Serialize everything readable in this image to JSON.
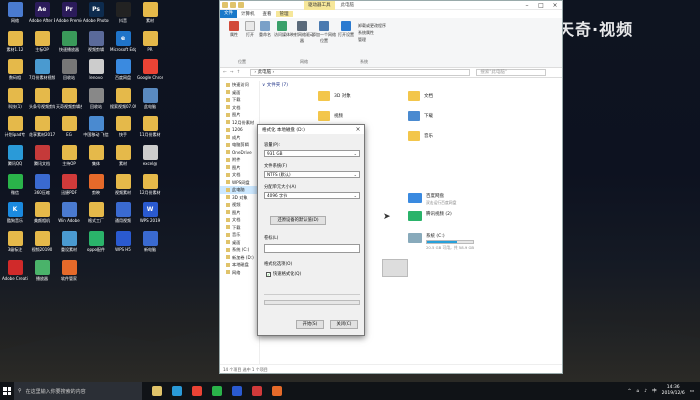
{
  "watermark": {
    "brand": "天奇·视频"
  },
  "desktop_icons": [
    {
      "label": "网络",
      "color": "#4a7bd0",
      "glyph": ""
    },
    {
      "label": "Adobe After Effects CC...",
      "color": "#2b1b5a",
      "glyph": "Ae"
    },
    {
      "label": "Adobe Premiere P...",
      "color": "#2b1b5a",
      "glyph": "Pr"
    },
    {
      "label": "Adobe Photosh...",
      "color": "#0d2b4e",
      "glyph": "Ps"
    },
    {
      "label": "抖音",
      "color": "#222222",
      "glyph": ""
    },
    {
      "label": "素材",
      "color": "#e5b94a",
      "glyph": ""
    },
    {
      "label": "素材1.12",
      "color": "#e5b94a",
      "glyph": ""
    },
    {
      "label": "主标OP",
      "color": "#e5b94a",
      "glyph": ""
    },
    {
      "label": "快速播放器",
      "color": "#3a9a5a",
      "glyph": ""
    },
    {
      "label": "视频剪辑",
      "color": "#5a6a9a",
      "glyph": ""
    },
    {
      "label": "Microsoft Edge",
      "color": "#1f74c9",
      "glyph": "e"
    },
    {
      "label": "PR",
      "color": "#e5b94a",
      "glyph": ""
    },
    {
      "label": "数码相",
      "color": "#e5b94a",
      "glyph": ""
    },
    {
      "label": "7月份素材视频",
      "color": "#4a9ad0",
      "glyph": ""
    },
    {
      "label": "回收站",
      "color": "#777777",
      "glyph": ""
    },
    {
      "label": "lenovo",
      "color": "#cccccc",
      "glyph": ""
    },
    {
      "label": "百度网盘",
      "color": "#3a8ae0",
      "glyph": ""
    },
    {
      "label": "Google Chrome",
      "color": "#ea4335",
      "glyph": ""
    },
    {
      "label": "科技(1)",
      "color": "#e5b94a",
      "glyph": ""
    },
    {
      "label": "头条号视频剪辑",
      "color": "#e5b94a",
      "glyph": ""
    },
    {
      "label": "天奇视频剪辑合",
      "color": "#e5b94a",
      "glyph": ""
    },
    {
      "label": "回收站",
      "color": "#888888",
      "glyph": ""
    },
    {
      "label": "搜索视频07.09",
      "color": "#e5b94a",
      "glyph": ""
    },
    {
      "label": "此电脑",
      "color": "#5a8ac0",
      "glyph": ""
    },
    {
      "label": "计划ipad专",
      "color": "#e5b94a",
      "glyph": ""
    },
    {
      "label": "花享素材2017.08",
      "color": "#e5b94a",
      "glyph": ""
    },
    {
      "label": "EG",
      "color": "#e5b94a",
      "glyph": ""
    },
    {
      "label": "中国移动 飞信",
      "color": "#4a8ad0",
      "glyph": ""
    },
    {
      "label": "快手",
      "color": "#e5b94a",
      "glyph": ""
    },
    {
      "label": "11月份素材",
      "color": "#e5b94a",
      "glyph": ""
    },
    {
      "label": "腾讯QQ",
      "color": "#2a9ad8",
      "glyph": ""
    },
    {
      "label": "腾讯文档",
      "color": "#c53a3a",
      "glyph": ""
    },
    {
      "label": "主持OP",
      "color": "#e5b94a",
      "glyph": ""
    },
    {
      "label": "集体",
      "color": "#e5b94a",
      "glyph": ""
    },
    {
      "label": "素材",
      "color": "#e5b94a",
      "glyph": ""
    },
    {
      "label": "excel@",
      "color": "#cccccc",
      "glyph": ""
    },
    {
      "label": "微信",
      "color": "#2ab34a",
      "glyph": ""
    },
    {
      "label": "360压缩",
      "color": "#3a6ad0",
      "glyph": ""
    },
    {
      "label": "迅捷PDF",
      "color": "#d03a3a",
      "glyph": ""
    },
    {
      "label": "剪映",
      "color": "#e56a2a",
      "glyph": ""
    },
    {
      "label": "视频素材",
      "color": "#e5b94a",
      "glyph": ""
    },
    {
      "label": "12月份素材",
      "color": "#e5b94a",
      "glyph": ""
    },
    {
      "label": "酷狗音乐",
      "color": "#1a8ae0",
      "glyph": "K"
    },
    {
      "label": "美颜相机",
      "color": "#e5b94a",
      "glyph": ""
    },
    {
      "label": "Win Adobe",
      "color": "#4a7ad0",
      "glyph": ""
    },
    {
      "label": "格式工厂",
      "color": "#e5b94a",
      "glyph": ""
    },
    {
      "label": "通用视频",
      "color": "#3a6ad0",
      "glyph": ""
    },
    {
      "label": "WPS 2019",
      "color": "#2a5ad0",
      "glyph": "W"
    },
    {
      "label": "3级标注",
      "color": "#e5b94a",
      "glyph": ""
    },
    {
      "label": "视频20190",
      "color": "#e5b94a",
      "glyph": ""
    },
    {
      "label": "重设素材",
      "color": "#4a9ad0",
      "glyph": ""
    },
    {
      "label": "oppo配件",
      "color": "#2ab36a",
      "glyph": ""
    },
    {
      "label": "WPS H5",
      "color": "#2a5ad0",
      "glyph": ""
    },
    {
      "label": "新电脑",
      "color": "#3a6ad0",
      "glyph": ""
    },
    {
      "label": "Adobe Creati...",
      "color": "#d02a2a",
      "glyph": ""
    },
    {
      "label": "播放器",
      "color": "#4ab36a",
      "glyph": ""
    },
    {
      "label": "软件管家",
      "color": "#e56a2a",
      "glyph": ""
    }
  ],
  "explorer": {
    "tools_tab": "驱动器工具",
    "title": "此电脑",
    "tabs": [
      "文件",
      "计算机",
      "查看",
      "管理"
    ],
    "ribbon_buttons": [
      "属性",
      "打开",
      "重命名",
      "访问媒体",
      "映射网络驱动器",
      "添加一个网络位置",
      "打开设置",
      "卸载或更改程序",
      "系统属性",
      "管理"
    ],
    "ribbon_groups": [
      "位置",
      "网络",
      "系统"
    ],
    "path": "› 此电脑 ›",
    "search_placeholder": "搜索\"此电脑\"",
    "nav": [
      "快速访问",
      "桌面",
      "下载",
      "文档",
      "图片",
      "12月份素材",
      "1206",
      "成片",
      "电脑剪辑",
      "OneDrive",
      "附件",
      "图片",
      "文档",
      "WPS网盘",
      "此电脑",
      "3D 对象",
      "视频",
      "图片",
      "文档",
      "下载",
      "音乐",
      "桌面",
      "系统 (C:)",
      "新加卷 (D:)",
      "本地磁盘",
      "网络"
    ],
    "section": "∨ 文件夹 (7)",
    "folders": [
      "3D 对象",
      "视频",
      "图片",
      "文档",
      "下载",
      "音乐"
    ],
    "devices": [
      {
        "name": "百度网盘",
        "sub": "双击运行百度网盘"
      },
      {
        "name": "腾讯视频 (2)",
        "sub": ""
      },
      {
        "name": "系统 (C:)",
        "sub": "20.5 GB 可用，共 58.9 GB",
        "used": 0.65
      }
    ],
    "status": "14 个项目    选中 1 个项目"
  },
  "dialog": {
    "title": "格式化 本地磁盘 (D:)",
    "capacity_label": "容量(P):",
    "capacity_value": "931 GB",
    "fs_label": "文件系统(F)",
    "fs_value": "NTFS (默认)",
    "alloc_label": "分配单元大小(A)",
    "alloc_value": "4096 字节",
    "restore_btn": "还原设备的默认值(D)",
    "volume_label": "卷标(L)",
    "volume_value": "",
    "options_label": "格式化选项(O)",
    "quick_format": "快速格式化(Q)",
    "start_btn": "开始(S)",
    "close_btn": "关闭(C)"
  },
  "taskbar": {
    "search_placeholder": "在这里输入你要搜索的内容",
    "time": "14:36",
    "date": "2019/12/6",
    "ime": "中",
    "app_colors": [
      "#e0c36a",
      "#2a9ad8",
      "#ea4335",
      "#2ab34a",
      "#2a5ad0",
      "#d03a3a",
      "#e56a2a"
    ]
  }
}
